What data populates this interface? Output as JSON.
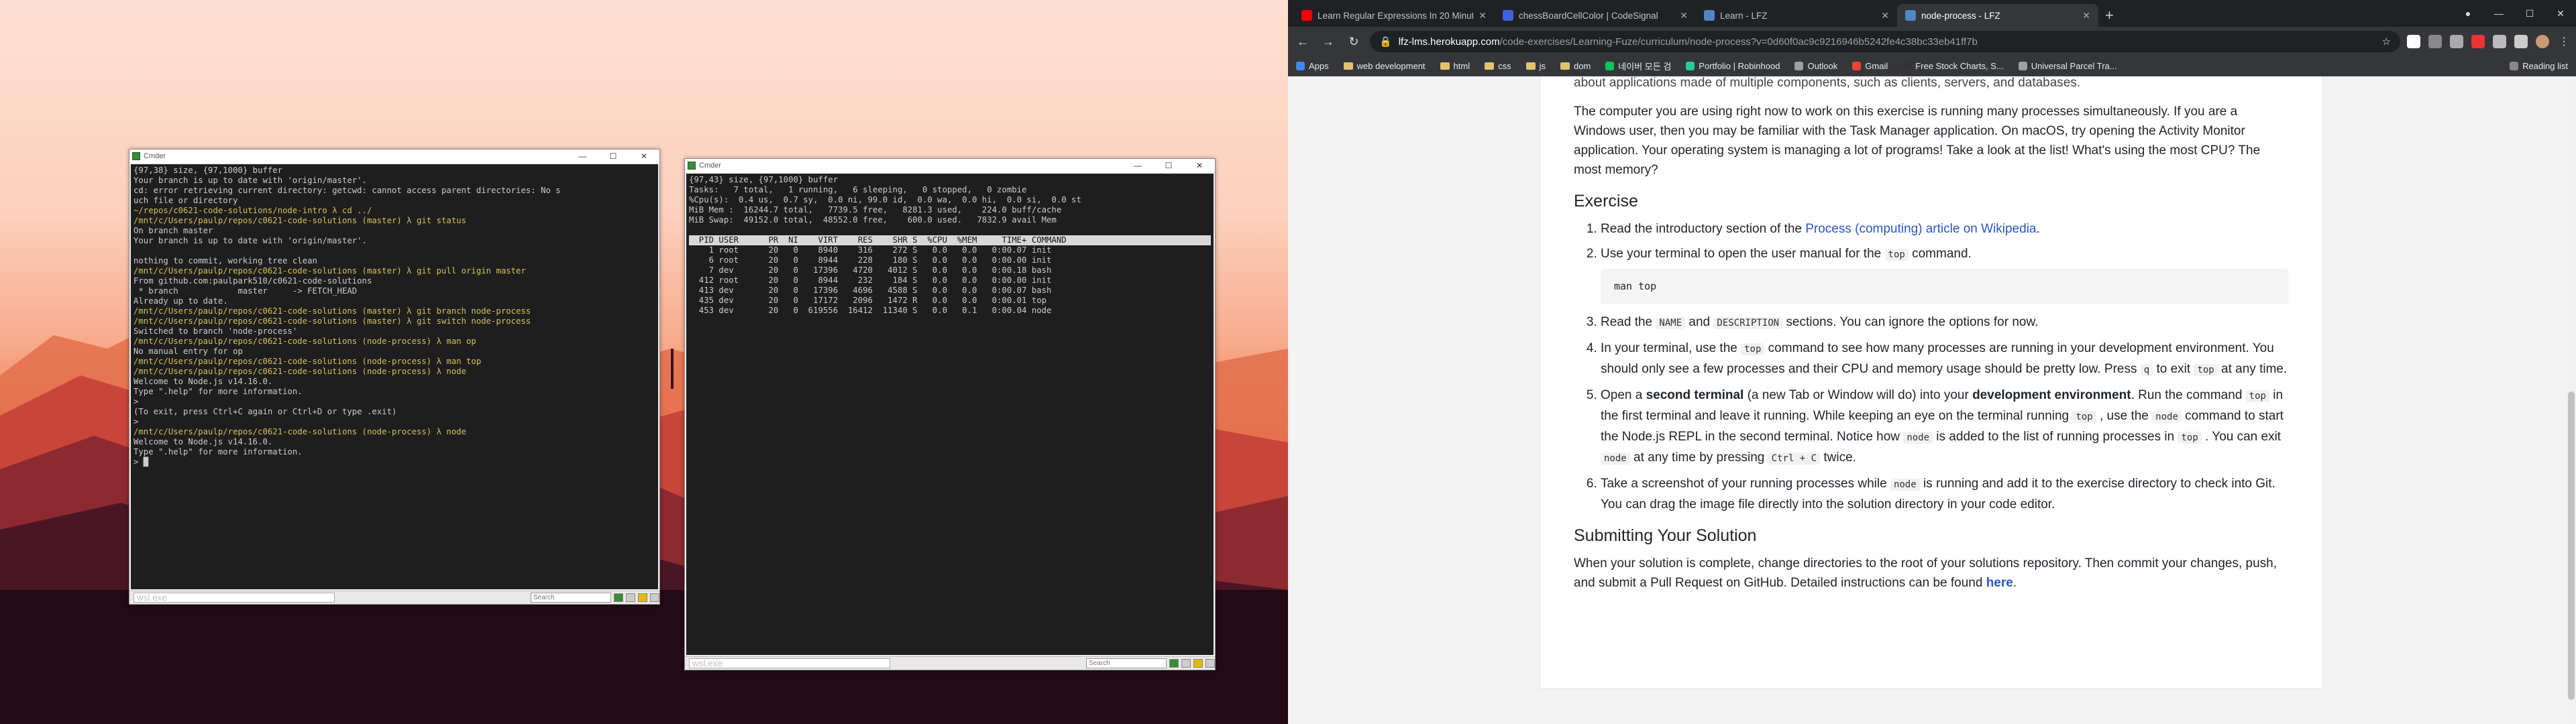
{
  "left_window": {
    "title": "Cmder",
    "status_tab": "wsl.exe",
    "search_placeholder": "Search",
    "lines": [
      {
        "t": "{97,38} size, {97,1000} buffer",
        "c": ""
      },
      {
        "t": "Your branch is up to date with 'origin/master'.",
        "c": ""
      },
      {
        "t": "cd: error retrieving current directory: getcwd: cannot access parent directories: No s",
        "c": ""
      },
      {
        "t": "uch file or directory",
        "c": ""
      },
      {
        "t": "~/repos/c0621-code-solutions/node-intro λ cd ../",
        "c": "y"
      },
      {
        "t": "/mnt/c/Users/paulp/repos/c0621-code-solutions (master) λ git status",
        "c": "y"
      },
      {
        "t": "On branch master",
        "c": ""
      },
      {
        "t": "Your branch is up to date with 'origin/master'.",
        "c": ""
      },
      {
        "t": "",
        "c": ""
      },
      {
        "t": "nothing to commit, working tree clean",
        "c": ""
      },
      {
        "t": "/mnt/c/Users/paulp/repos/c0621-code-solutions (master) λ git pull origin master",
        "c": "y"
      },
      {
        "t": "From github.com:paulpark510/c0621-code-solutions",
        "c": ""
      },
      {
        "t": " * branch            master     -> FETCH_HEAD",
        "c": ""
      },
      {
        "t": "Already up to date.",
        "c": ""
      },
      {
        "t": "/mnt/c/Users/paulp/repos/c0621-code-solutions (master) λ git branch node-process",
        "c": "y"
      },
      {
        "t": "/mnt/c/Users/paulp/repos/c0621-code-solutions (master) λ git switch node-process",
        "c": "y"
      },
      {
        "t": "Switched to branch 'node-process'",
        "c": ""
      },
      {
        "t": "/mnt/c/Users/paulp/repos/c0621-code-solutions (node-process) λ man op",
        "c": "y"
      },
      {
        "t": "No manual entry for op",
        "c": ""
      },
      {
        "t": "/mnt/c/Users/paulp/repos/c0621-code-solutions (node-process) λ man top",
        "c": "y"
      },
      {
        "t": "/mnt/c/Users/paulp/repos/c0621-code-solutions (node-process) λ node",
        "c": "y"
      },
      {
        "t": "Welcome to Node.js v14.16.0.",
        "c": ""
      },
      {
        "t": "Type \".help\" for more information.",
        "c": ""
      },
      {
        "t": ">",
        "c": ""
      },
      {
        "t": "(To exit, press Ctrl+C again or Ctrl+D or type .exit)",
        "c": ""
      },
      {
        "t": ">",
        "c": ""
      },
      {
        "t": "/mnt/c/Users/paulp/repos/c0621-code-solutions (node-process) λ node",
        "c": "y"
      },
      {
        "t": "Welcome to Node.js v14.16.0.",
        "c": ""
      },
      {
        "t": "Type \".help\" for more information.",
        "c": ""
      },
      {
        "t": "> █",
        "c": ""
      }
    ]
  },
  "right_window": {
    "title": "Cmder",
    "status_tab": "wsl.exe",
    "search_placeholder": "Search",
    "lines": [
      {
        "t": "{97,43} size, {97,1000} buffer",
        "c": ""
      },
      {
        "t": "Tasks:   7 total,   1 running,   6 sleeping,   0 stopped,   0 zombie",
        "c": ""
      },
      {
        "t": "%Cpu(s):  0.4 us,  0.7 sy,  0.0 ni, 99.0 id,  0.0 wa,  0.0 hi,  0.0 si,  0.0 st",
        "c": ""
      },
      {
        "t": "MiB Mem :  16244.7 total,   7739.5 free,   8281.3 used,    224.0 buff/cache",
        "c": ""
      },
      {
        "t": "MiB Swap:  49152.0 total,  48552.0 free,    600.0 used.   7832.9 avail Mem",
        "c": ""
      },
      {
        "t": "",
        "c": ""
      },
      {
        "t": "  PID USER      PR  NI    VIRT    RES    SHR S  %CPU  %MEM     TIME+ COMMAND  ",
        "c": "hl"
      },
      {
        "t": "    1 root      20   0    8940    316    272 S   0.0   0.0   0:00.07 init",
        "c": ""
      },
      {
        "t": "    6 root      20   0    8944    228    180 S   0.0   0.0   0:00.00 init",
        "c": ""
      },
      {
        "t": "    7 dev       20   0   17396   4720   4012 S   0.0   0.0   0:00.18 bash",
        "c": ""
      },
      {
        "t": "  412 root      20   0    8944    232    184 S   0.0   0.0   0:00.00 init",
        "c": ""
      },
      {
        "t": "  413 dev       20   0   17396   4696   4588 S   0.0   0.0   0:00.07 bash",
        "c": ""
      },
      {
        "t": "  435 dev       20   0   17172   2096   1472 R   0.0   0.0   0:00.01 top",
        "c": ""
      },
      {
        "t": "  453 dev       20   0  619556  16412  11340 S   0.0   0.1   0:00.04 node",
        "c": ""
      }
    ]
  },
  "browser": {
    "tabs": [
      {
        "title": "Learn Regular Expressions In 20 Minutes",
        "color": "#ff0000",
        "active": false
      },
      {
        "title": "chessBoardCellColor | CodeSignal",
        "color": "#3e63dd",
        "active": false
      },
      {
        "title": "Learn - LFZ",
        "color": "#4f86c6",
        "active": false
      },
      {
        "title": "node-process - LFZ",
        "color": "#4f86c6",
        "active": true
      }
    ],
    "url_host": "lfz-lms.herokuapp.com",
    "url_path": "/code-exercises/Learning-Fuze/curriculum/node-process?v=0d60f0ac9c9216946b5242fe4c38bc33eb41ff7b",
    "bookmarks": [
      {
        "label": "Apps",
        "kind": "apps"
      },
      {
        "label": "web development",
        "kind": "folder"
      },
      {
        "label": "html",
        "kind": "folder"
      },
      {
        "label": "css",
        "kind": "folder"
      },
      {
        "label": "js",
        "kind": "folder"
      },
      {
        "label": "dom",
        "kind": "folder"
      },
      {
        "label": "네이버 모든 검",
        "kind": "naver"
      },
      {
        "label": "Portfolio | Robinhood",
        "kind": "robinhood"
      },
      {
        "label": "Outlook",
        "kind": "web"
      },
      {
        "label": "Gmail",
        "kind": "gmail"
      },
      {
        "label": "Free Stock Charts, S...",
        "kind": "tv"
      },
      {
        "label": "Universal Parcel Tra...",
        "kind": "web"
      }
    ],
    "reading_list": "Reading list"
  },
  "doc": {
    "intro_tail": "about applications made of multiple components, such as clients, servers, and databases.",
    "para1": "The computer you are using right now to work on this exercise is running many processes simultaneously. If you are a Windows user, then you may be familiar with the Task Manager application. On macOS, try opening the Activity Monitor application. Your operating system is managing a lot of programs! Take a look at the list! What's using the most CPU? The most memory?",
    "exercise_heading": "Exercise",
    "s1_pre": "Read the introductory section of the ",
    "s1_link": "Process (computing) article on Wikipedia",
    "s1_post": ".",
    "s2_pre": "Use your terminal to open the user manual for the ",
    "s2_code": "top",
    "s2_post": " command.",
    "s2_block": "man top",
    "s3_pre": "Read the ",
    "s3_code1": "NAME",
    "s3_mid": " and ",
    "s3_code2": "DESCRIPTION",
    "s3_post": " sections. You can ignore the options for now.",
    "s4_pre": "In your terminal, use the ",
    "s4_code": "top",
    "s4_mid": " command to see how many processes are running in your development environment. You should only see a few processes and their CPU and memory usage should be pretty low. Press ",
    "s4_code2": "q",
    "s4_mid2": " to exit ",
    "s4_code3": "top",
    "s4_post": " at any time.",
    "s5_pre": "Open a ",
    "s5_b1": "second terminal",
    "s5_mid1": " (a new Tab or Window will do) into your ",
    "s5_b2": "development environment",
    "s5_mid2": ". Run the command ",
    "s5_code1": "top",
    "s5_mid3": " in the first terminal and leave it running. While keeping an eye on the terminal running ",
    "s5_code2": "top",
    "s5_mid4": " , use the ",
    "s5_code3": "node",
    "s5_mid5": " command to start the Node.js REPL in the second terminal. Notice how ",
    "s5_code4": "node",
    "s5_mid6": " is added to the list of running processes in ",
    "s5_code5": "top",
    "s5_mid7": " . You can exit ",
    "s5_code6": "node",
    "s5_mid8": " at any time by pressing ",
    "s5_code7": "Ctrl + C",
    "s5_post": " twice.",
    "s6_pre": "Take a screenshot of your running processes while ",
    "s6_code": "node",
    "s6_post": " is running and add it to the exercise directory to check into Git. You can drag the image file directly into the solution directory in your code editor.",
    "submit_heading": "Submitting Your Solution",
    "submit_text": "When your solution is complete, change directories to the root of your solutions repository. Then commit your changes, push, and submit a Pull Request on GitHub. Detailed instructions can be found ",
    "submit_link": "here",
    "submit_end": "."
  }
}
